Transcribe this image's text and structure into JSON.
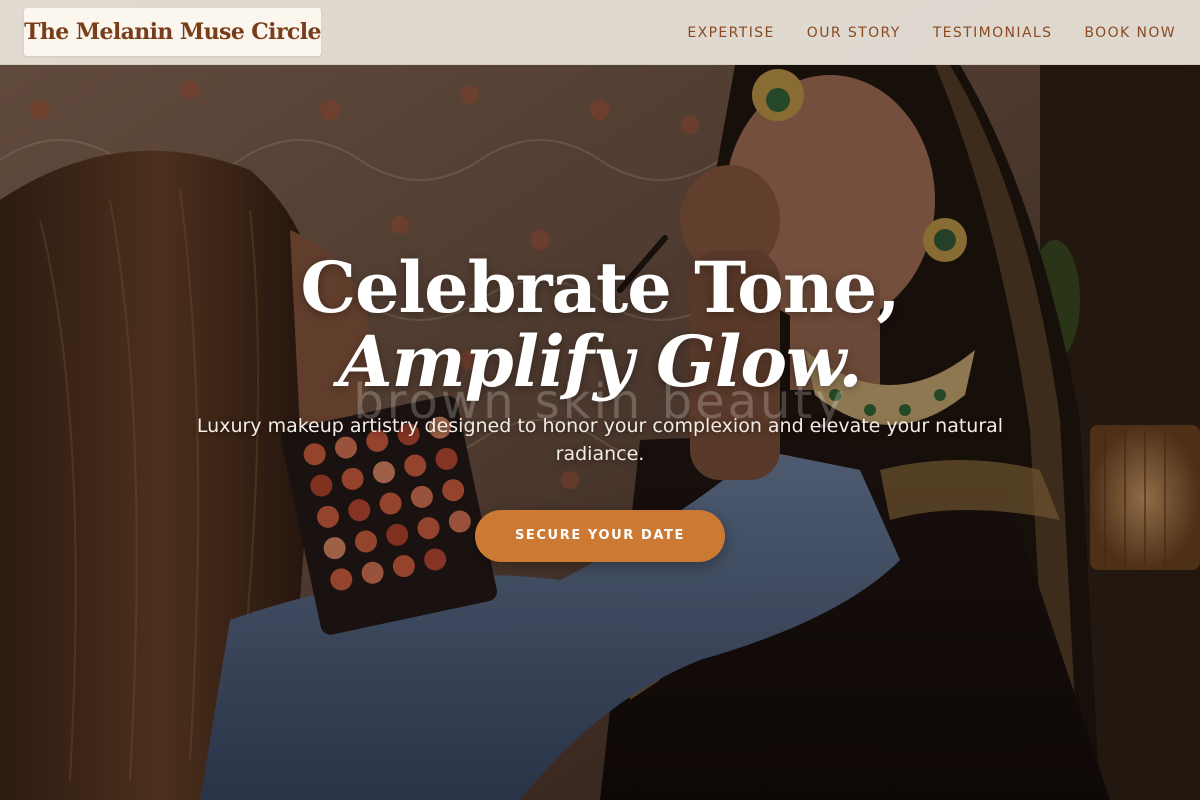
{
  "header": {
    "brand": "The Melanin Muse Circle",
    "nav": [
      {
        "label": "EXPERTISE"
      },
      {
        "label": "OUR STORY"
      },
      {
        "label": "TESTIMONIALS"
      },
      {
        "label": "BOOK NOW"
      }
    ]
  },
  "hero": {
    "headline_line1": "Celebrate Tone,",
    "headline_line2": "Amplify Glow.",
    "watermark": "brown skin beauty",
    "subheading": "Luxury makeup artistry designed to honor your complexion and elevate your natural radiance.",
    "cta_label": "SECURE YOUR DATE"
  },
  "colors": {
    "brand_text": "#7a3d1a",
    "nav_text": "#8a4a22",
    "header_bg": "#ece6dd",
    "cta_bg": "#cc7a33",
    "cta_text": "#ffffff"
  }
}
